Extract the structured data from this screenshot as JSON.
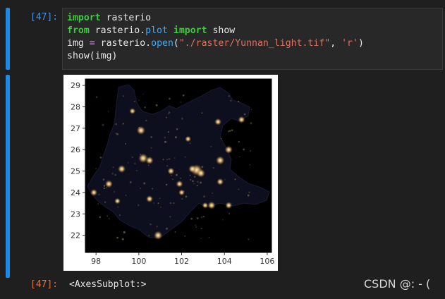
{
  "cell": {
    "input_prompt": "[47]:",
    "output_prompt": "[47]:",
    "code": {
      "line1": {
        "kw": "import",
        "rest": " rasterio"
      },
      "line2": {
        "kw1": "from",
        "mid": " rasterio.",
        "fn": "plot",
        "sp": " ",
        "kw2": "import",
        "rest": " show"
      },
      "line3": {
        "lhs": "img ",
        "op": "=",
        "mid": " rasterio.",
        "fn": "open",
        "p1": "(",
        "s1": "\"./raster/Yunnan_light.tif\"",
        "comma": ", ",
        "s2": "'r'",
        "p2": ")"
      },
      "line4": "show(img)"
    },
    "output_text": "<AxesSubplot:>"
  },
  "colors": {
    "accent": "#1e8ae6",
    "input_prompt": "#4a8fe0",
    "output_prompt": "#e07040",
    "plot_background": "#000000"
  },
  "chart_data": {
    "type": "heatmap",
    "title": "",
    "xlabel": "",
    "ylabel": "",
    "x_ticks": [
      "98",
      "100",
      "102",
      "104",
      "106"
    ],
    "y_ticks": [
      "29",
      "28",
      "27",
      "26",
      "25",
      "24",
      "23",
      "22"
    ],
    "xlim": [
      97.5,
      106.2
    ],
    "ylim": [
      21.2,
      29.3
    ],
    "points": [
      {
        "x": 102.7,
        "y": 25.05,
        "v": 1.0
      },
      {
        "x": 102.9,
        "y": 24.9,
        "v": 0.7
      },
      {
        "x": 102.5,
        "y": 25.1,
        "v": 0.6
      },
      {
        "x": 103.8,
        "y": 25.5,
        "v": 0.7
      },
      {
        "x": 104.2,
        "y": 26.0,
        "v": 0.6
      },
      {
        "x": 100.2,
        "y": 25.6,
        "v": 0.8
      },
      {
        "x": 100.5,
        "y": 25.5,
        "v": 0.6
      },
      {
        "x": 100.1,
        "y": 26.9,
        "v": 0.7
      },
      {
        "x": 99.2,
        "y": 25.1,
        "v": 0.6
      },
      {
        "x": 98.6,
        "y": 24.4,
        "v": 0.6
      },
      {
        "x": 97.9,
        "y": 24.0,
        "v": 0.5
      },
      {
        "x": 100.9,
        "y": 22.0,
        "v": 0.7
      },
      {
        "x": 100.5,
        "y": 23.7,
        "v": 0.5
      },
      {
        "x": 101.9,
        "y": 24.4,
        "v": 0.5
      },
      {
        "x": 103.4,
        "y": 23.4,
        "v": 0.6
      },
      {
        "x": 104.2,
        "y": 23.4,
        "v": 0.5
      },
      {
        "x": 103.8,
        "y": 24.5,
        "v": 0.5
      },
      {
        "x": 104.8,
        "y": 27.4,
        "v": 0.5
      },
      {
        "x": 103.7,
        "y": 27.3,
        "v": 0.5
      },
      {
        "x": 99.7,
        "y": 27.8,
        "v": 0.4
      },
      {
        "x": 99.0,
        "y": 23.6,
        "v": 0.4
      },
      {
        "x": 101.5,
        "y": 25.0,
        "v": 0.5
      },
      {
        "x": 102.3,
        "y": 26.5,
        "v": 0.4
      },
      {
        "x": 102.0,
        "y": 24.0,
        "v": 0.4
      },
      {
        "x": 103.1,
        "y": 23.4,
        "v": 0.4
      }
    ]
  },
  "watermark": "CSDN @: - ("
}
